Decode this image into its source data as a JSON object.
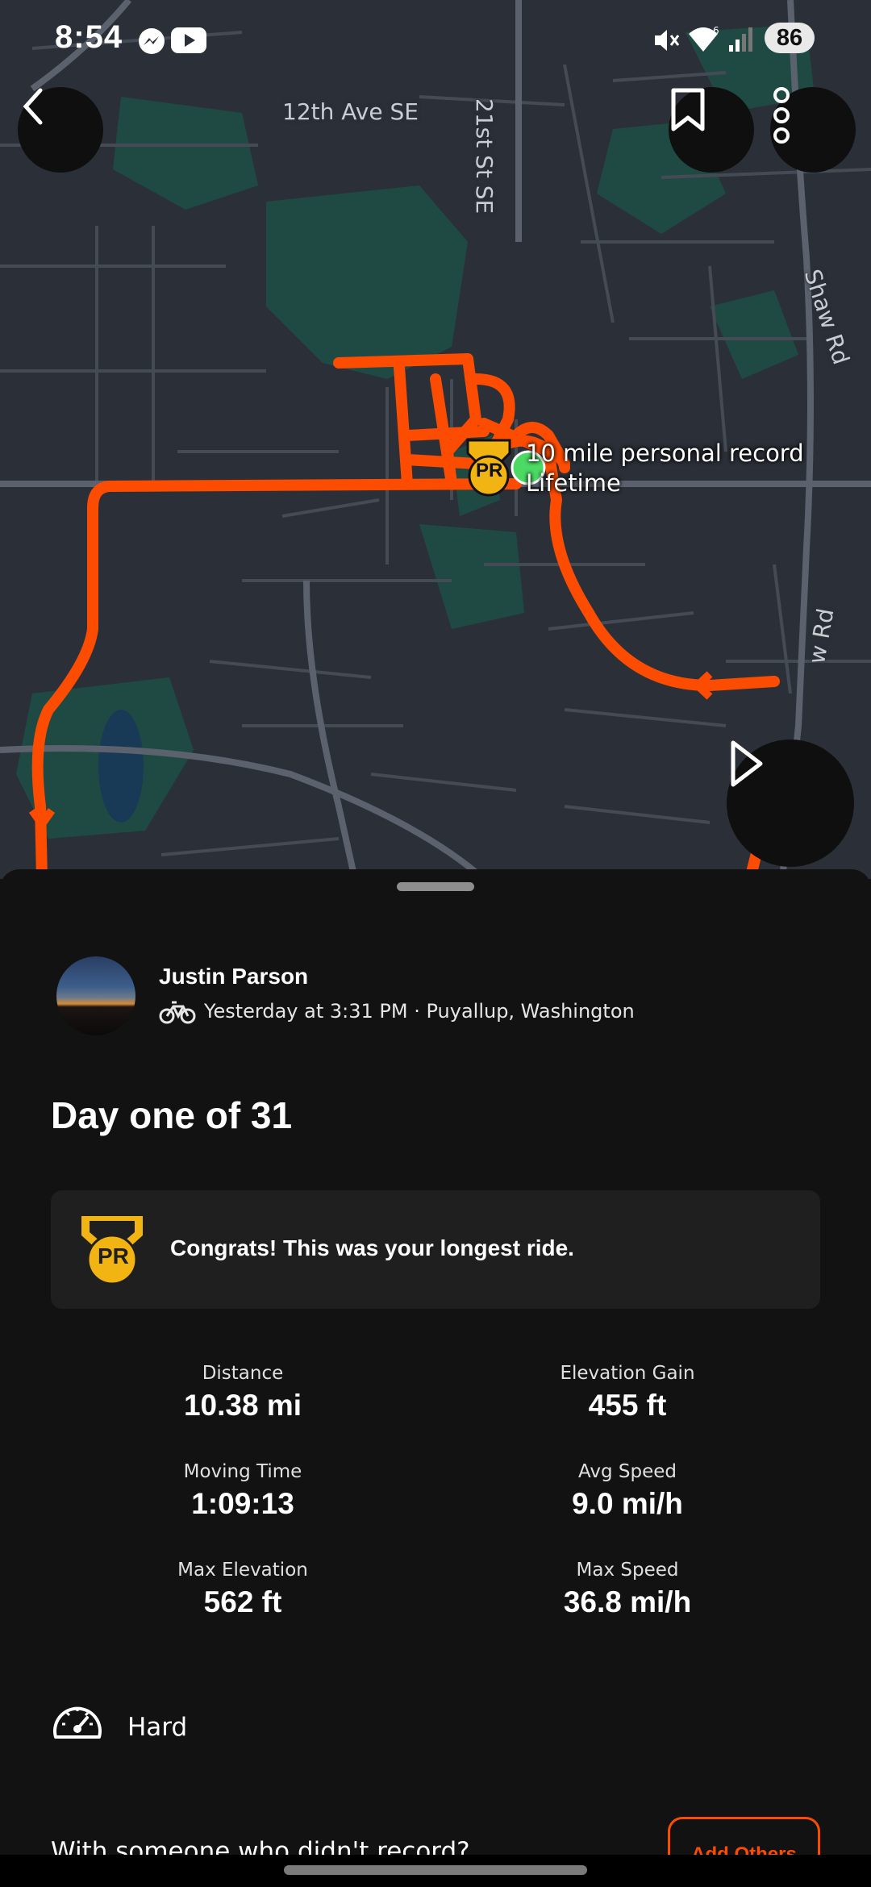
{
  "status_bar": {
    "time": "8:54",
    "battery": "86",
    "icons": [
      "messenger-icon",
      "youtube-icon",
      "mute-icon",
      "wifi-6-icon",
      "signal-icon"
    ]
  },
  "map": {
    "street_labels": [
      "12th Ave SE",
      "21st St SE",
      "Shaw Rd",
      "w Rd"
    ],
    "pr_callout": {
      "line1": "10 mile personal record",
      "line2": "Lifetime",
      "badge": "PR"
    },
    "route_color": "#fc4c02",
    "park_color": "#1f4a43"
  },
  "toolbar": {
    "back": "back-icon",
    "bookmark": "bookmark-icon",
    "more": "more-vertical-icon",
    "play": "play-icon"
  },
  "activity": {
    "athlete_name": "Justin Parson",
    "sport_icon": "bike-icon",
    "meta": "Yesterday at 3:31 PM · Puyallup, Washington",
    "title": "Day one of 31"
  },
  "pr_card": {
    "badge": "PR",
    "message": "Congrats! This was your longest ride."
  },
  "stats": [
    {
      "label": "Distance",
      "value": "10.38 mi"
    },
    {
      "label": "Elevation Gain",
      "value": "455 ft"
    },
    {
      "label": "Moving Time",
      "value": "1:09:13"
    },
    {
      "label": "Avg Speed",
      "value": "9.0 mi/h"
    },
    {
      "label": "Max Elevation",
      "value": "562 ft"
    },
    {
      "label": "Max Speed",
      "value": "36.8 mi/h"
    }
  ],
  "effort": {
    "icon": "speedometer-icon",
    "label": "Hard"
  },
  "others": {
    "prompt": "With someone who didn't record?",
    "button": "Add Others"
  },
  "colors": {
    "accent": "#fc4c02",
    "medal": "#f2b412",
    "sheet_bg": "#121212",
    "card_bg": "#1f1f1f"
  }
}
